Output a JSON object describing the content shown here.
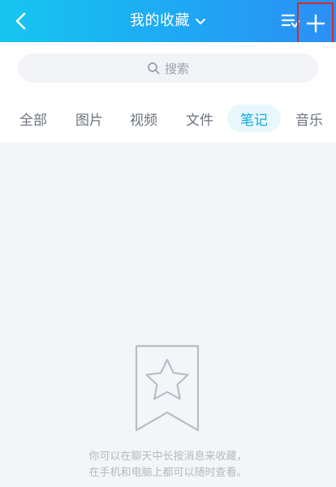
{
  "header": {
    "title": "我的收藏",
    "back_icon": "chevron-left-icon",
    "title_dropdown_icon": "chevron-down-icon",
    "list_icon": "list-sort-icon",
    "add_icon": "plus-icon",
    "highlight_color": "#d82a2a"
  },
  "search": {
    "placeholder": "搜索",
    "icon": "search-icon"
  },
  "tabs": [
    {
      "label": "全部",
      "active": false
    },
    {
      "label": "图片",
      "active": false
    },
    {
      "label": "视频",
      "active": false
    },
    {
      "label": "文件",
      "active": false
    },
    {
      "label": "笔记",
      "active": true
    },
    {
      "label": "音乐",
      "active": false
    }
  ],
  "empty_state": {
    "icon": "bookmark-star-icon",
    "line1": "你可以在聊天中长按消息来收藏，",
    "line2": "在手机和电脑上都可以随时查看。"
  },
  "colors": {
    "accent": "#17a8d8",
    "header_gradient_start": "#16c6ef",
    "header_gradient_end": "#2b8ff5"
  }
}
